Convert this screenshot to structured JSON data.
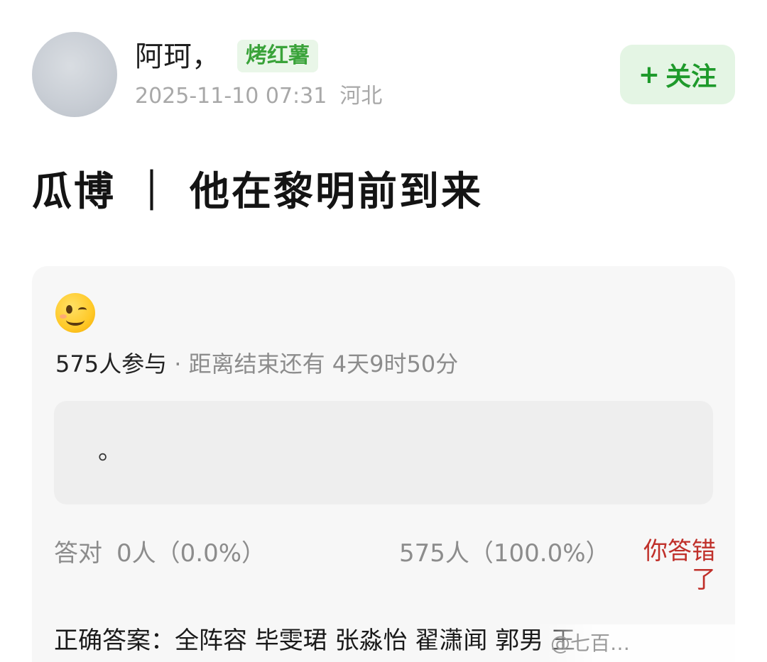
{
  "post": {
    "author": "阿珂，",
    "tag": "烤红薯",
    "datetime": "2025-11-10 07:31",
    "location": "河北",
    "follow": {
      "plus": "+",
      "label": "关注"
    },
    "title": "瓜博 ｜ 他在黎明前到来"
  },
  "quiz": {
    "emoji": "winking-face-emoji",
    "participants": "575人参与",
    "remaining": " · 距离结束还有 4天9时50分",
    "option_text": "。",
    "correct_label": "答对",
    "correct_stat": "0人（0.0%）",
    "other_stat": "575人（100.0%）",
    "result": "你答错了",
    "answer": "正确答案：全阵容 毕雯珺 张淼怡 翟潇闻 郭男 王"
  },
  "watermark": "@七百…",
  "colors": {
    "tag_green": "#3aa33a",
    "follow_green": "#1e9a2b",
    "wrong_red": "#c0302a"
  }
}
